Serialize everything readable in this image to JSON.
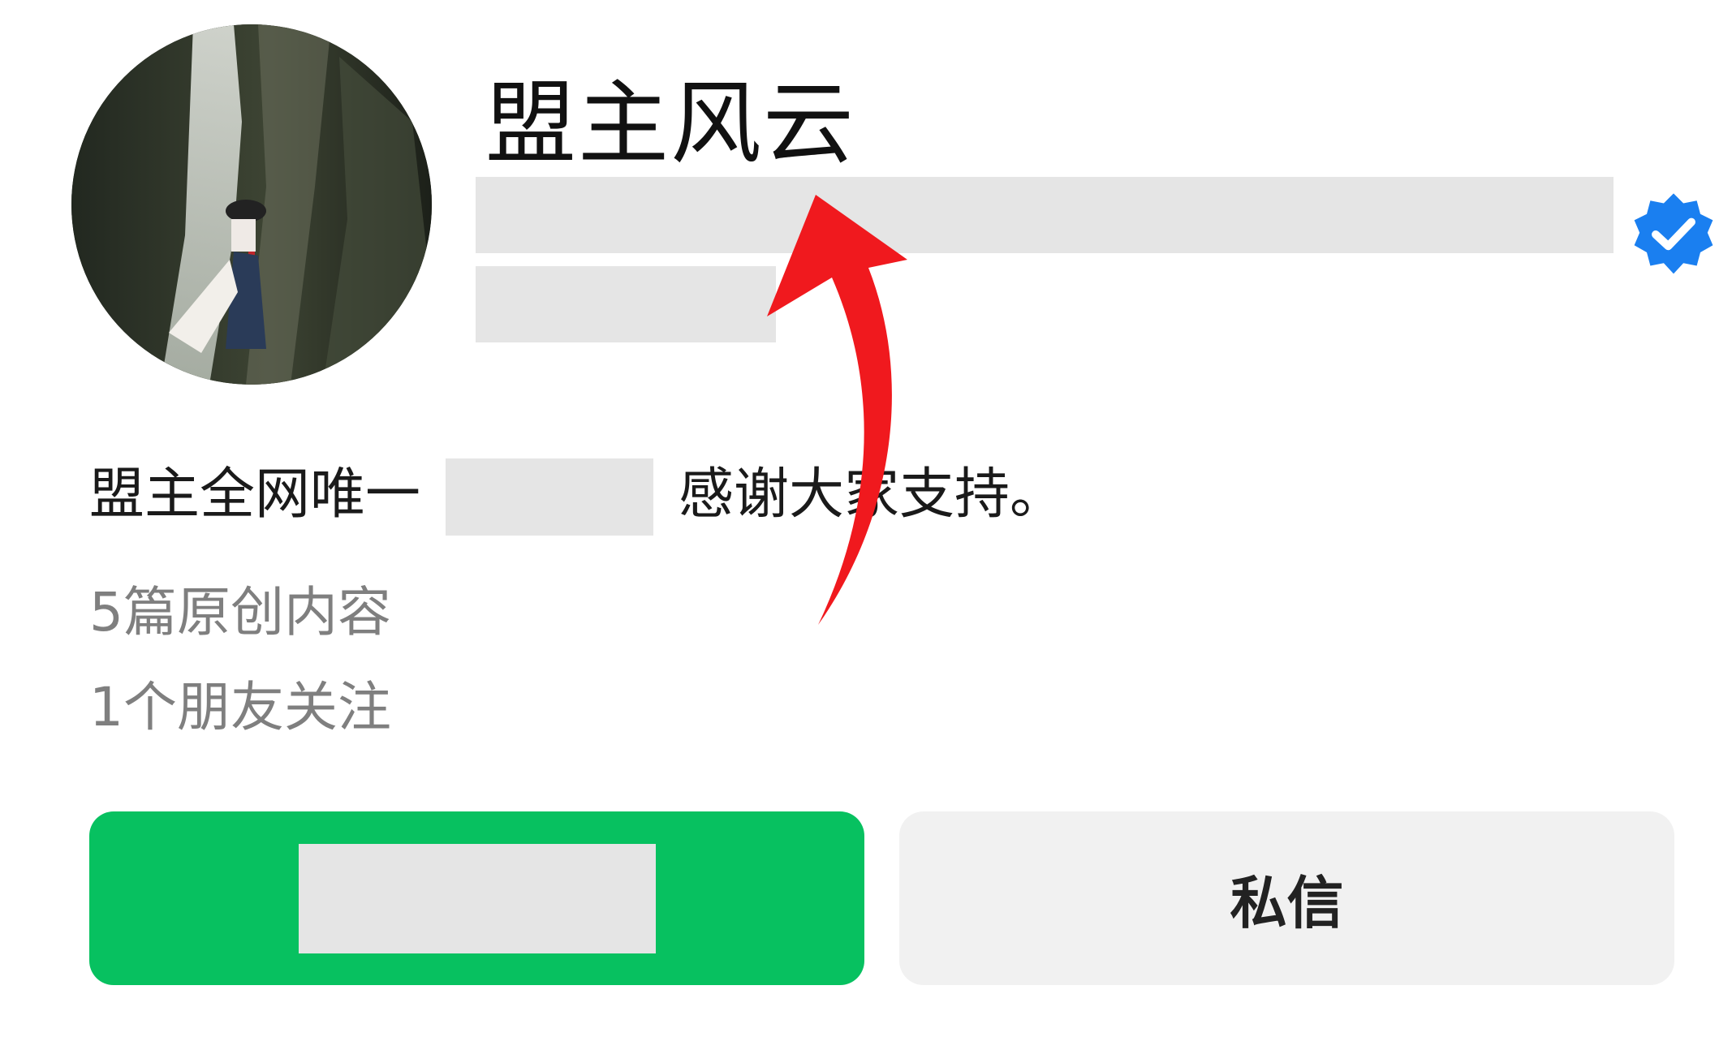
{
  "profile": {
    "name": "盟主风云",
    "verified_icon": "verified-badge-icon",
    "bio_prefix": "盟主全网唯一",
    "bio_suffix": "感谢大家支持。",
    "stats": {
      "articles": "5篇原创内容",
      "friends": "1个朋友关注"
    }
  },
  "actions": {
    "message_label": "私信"
  },
  "colors": {
    "follow_button": "#07c160",
    "message_button": "#f1f1f1",
    "verified_blue": "#1a7ff0",
    "annotation_arrow": "#f0191e",
    "redaction": "#e5e5e5"
  }
}
